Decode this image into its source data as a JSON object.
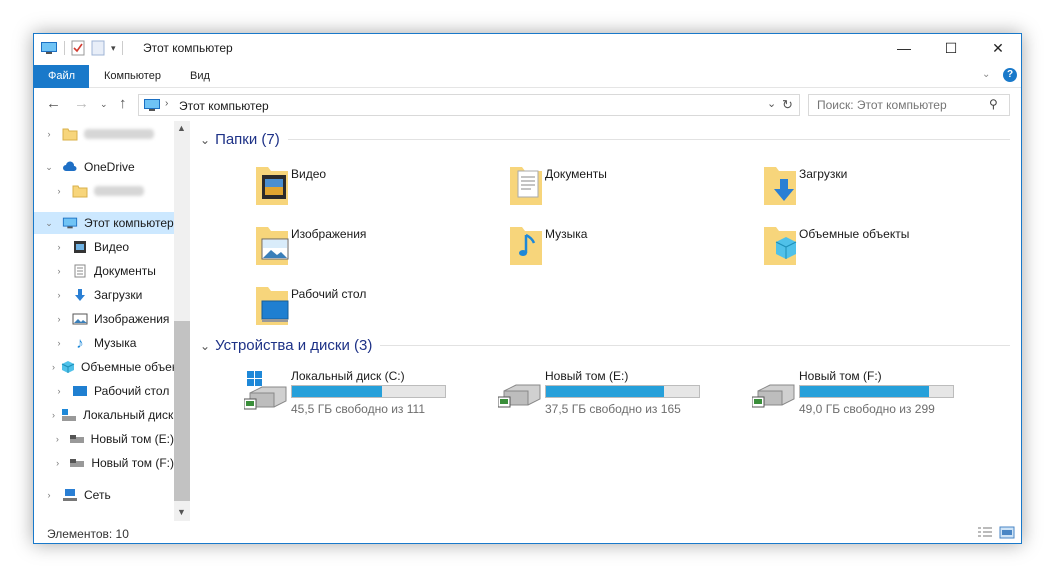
{
  "titlebar": {
    "title": "Этот компьютер",
    "minimize": "—",
    "maximize": "☐",
    "close": "✕"
  },
  "ribbon": {
    "tabs": [
      "Файл",
      "Компьютер",
      "Вид"
    ]
  },
  "address": {
    "path": "Этот компьютер",
    "search_placeholder": "Поиск: Этот компьютер"
  },
  "nav": {
    "onedrive": "OneDrive",
    "this_pc": "Этот компьютер",
    "items": [
      "Видео",
      "Документы",
      "Загрузки",
      "Изображения",
      "Музыка",
      "Объемные объекты",
      "Рабочий стол",
      "Локальный диск (C:)",
      "Новый том (E:)",
      "Новый том (F:)"
    ],
    "network": "Сеть"
  },
  "folders_group": {
    "title": "Папки (7)",
    "items": [
      "Видео",
      "Документы",
      "Загрузки",
      "Изображения",
      "Музыка",
      "Объемные объекты",
      "Рабочий стол"
    ]
  },
  "drives_group": {
    "title": "Устройства и диски (3)",
    "items": [
      {
        "name": "Локальный диск (C:)",
        "free": "45,5 ГБ свободно из 111",
        "used_fraction": 0.59
      },
      {
        "name": "Новый том (E:)",
        "free": "37,5 ГБ свободно из 165",
        "used_fraction": 0.77
      },
      {
        "name": "Новый том (F:)",
        "free": "49,0 ГБ свободно из 299",
        "used_fraction": 0.84
      }
    ]
  },
  "status": {
    "count": "Элементов: 10"
  },
  "colors": {
    "accent": "#1979ca",
    "bar": "#26a0da",
    "folder": "#f7d57b",
    "header": "#1e3287"
  }
}
